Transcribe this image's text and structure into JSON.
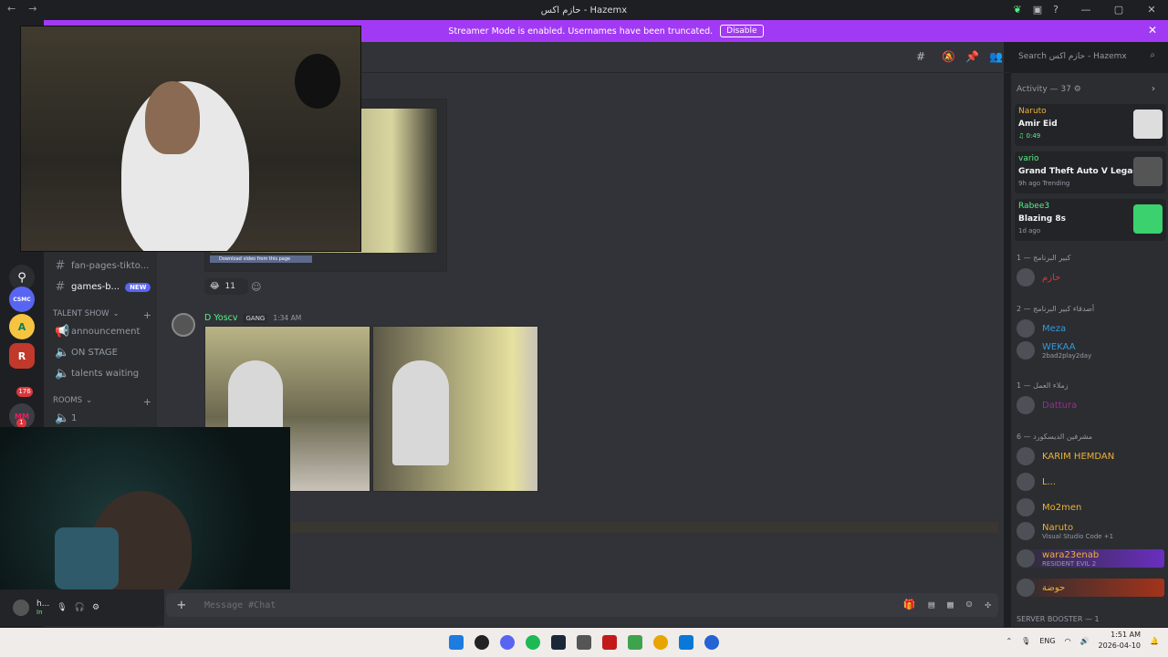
{
  "window": {
    "title": "حازم اكس - Hazemx",
    "controls": [
      "—",
      "▢",
      "✕"
    ]
  },
  "banner": {
    "text": "Streamer Mode is enabled. Usernames have been truncated.",
    "button": "Disable"
  },
  "guilds": {
    "badges": [
      "176",
      "1"
    ]
  },
  "channels": {
    "items": [
      {
        "label": "fan-pages-tikto...",
        "icon": "#"
      },
      {
        "label": "games-b...",
        "icon": "#",
        "badge": "NEW"
      }
    ],
    "talent_category": "TALENT SHOW",
    "talent_items": [
      "announcement",
      "ON STAGE",
      "talents waiting"
    ],
    "rooms_category": "ROOMS",
    "room_items": [
      "1"
    ]
  },
  "user": {
    "name": "h...",
    "status": "In"
  },
  "search": {
    "placeholder": "Search حازم اكس - Hazemx"
  },
  "message": {
    "reaction_count": "11",
    "author": "D Yoscv",
    "tag": "GANG",
    "time": "1:34 AM",
    "download_text": "Download video from this page"
  },
  "composer": {
    "placeholder": "Message #Chat"
  },
  "activity": {
    "header": "Activity — 37",
    "cards": [
      {
        "user": "Naruto",
        "title": "Amir Eid",
        "sub": "♫ 0:49",
        "color": "#f0b132"
      },
      {
        "user": "vario",
        "title": "Grand Theft Auto V Legacy",
        "sub": "9h ago  Trending",
        "color": "#57f287"
      },
      {
        "user": "Rabee3",
        "title": "Blazing 8s",
        "sub": "1d ago",
        "color": "#57f287"
      }
    ]
  },
  "members": {
    "sections": [
      "كبير البرنامج — 1",
      "أصدقاء كبير البرنامج — 2",
      "زملاء العمل — 1",
      "مشرفين الديسكورد — 6",
      "SERVER BOOSTER — 1"
    ],
    "list": [
      {
        "name": "حازم",
        "sub": "",
        "color": "#da373c"
      },
      {
        "name": "Meza",
        "sub": "",
        "color": "#3498db"
      },
      {
        "name": "WEKAA",
        "sub": "2bad2play2day",
        "color": "#3498db"
      },
      {
        "name": "Dattura",
        "sub": "",
        "color": "#9b2c8e"
      },
      {
        "name": "KARIM HEMDAN",
        "sub": "",
        "color": "#f0b132"
      },
      {
        "name": "L...",
        "sub": "",
        "color": "#f0b132"
      },
      {
        "name": "Mo2men",
        "sub": "",
        "color": "#f0b132"
      },
      {
        "name": "Naruto",
        "sub": "Visual Studio Code +1",
        "color": "#f0b132"
      },
      {
        "name": "wara23enab",
        "sub": "RESIDENT EVIL 2",
        "color": "#f0b132"
      },
      {
        "name": "حوضة",
        "sub": "",
        "color": "#f0b132"
      }
    ]
  },
  "tray": {
    "lang": "ENG",
    "time": "1:51 AM",
    "date": "2026-04-10"
  }
}
